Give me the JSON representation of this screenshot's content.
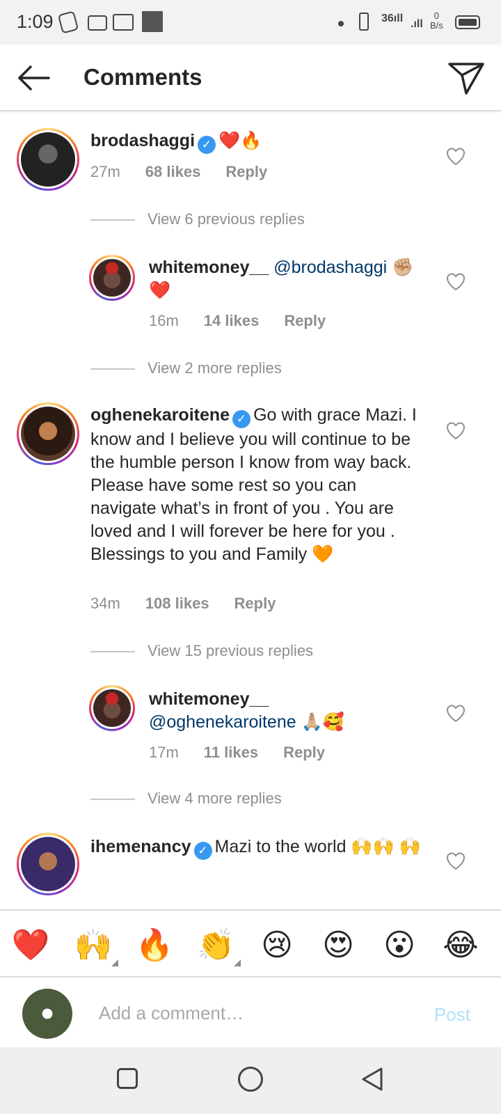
{
  "status_bar": {
    "time": "1:09",
    "network_label": "36",
    "speed_value": "0",
    "speed_unit": "B/s"
  },
  "header": {
    "title": "Comments",
    "back_icon": "arrow-left-icon",
    "dm_icon": "paper-plane-icon"
  },
  "comments": [
    {
      "username": "brodashaggi",
      "verified": true,
      "text": "❤️🔥",
      "time": "27m",
      "likes": "68 likes",
      "reply_label": "Reply",
      "view_replies": "View 6 previous replies",
      "replies": [
        {
          "username": "whitemoney__",
          "mention": "@brodashaggi",
          "text": "✊🏼 ❤️",
          "time": "16m",
          "likes": "14 likes",
          "reply_label": "Reply"
        }
      ],
      "more_replies": "View 2 more replies"
    },
    {
      "username": "oghenekaroitene",
      "verified": true,
      "text": "Go with grace Mazi. I know and I believe you will continue to be the humble person I know from way back. Please have some rest so you can navigate what’s in front of you . You are loved and I will forever be here for you . Blessings to you and Family 🧡",
      "time": "34m",
      "likes": "108 likes",
      "reply_label": "Reply",
      "view_replies": "View 15 previous replies",
      "replies": [
        {
          "username": "whitemoney__",
          "mention": "@oghenekaroitene",
          "text": "🙏🏼🥰",
          "time": "17m",
          "likes": "11 likes",
          "reply_label": "Reply"
        }
      ],
      "more_replies": "View 4 more replies"
    },
    {
      "username": "ihemenancy",
      "verified": true,
      "text": "Mazi to the world 🙌🙌 🙌"
    }
  ],
  "emoji_bar": [
    "❤️",
    "🙌",
    "🔥",
    "👏",
    "😢",
    "😍",
    "😮",
    "😂"
  ],
  "compose": {
    "placeholder": "Add a comment…",
    "post_label": "Post"
  },
  "colors": {
    "verified_blue": "#3897f0",
    "mention_blue": "#00376b",
    "post_disabled": "#b2dffc",
    "meta_gray": "#8e8e8e"
  }
}
